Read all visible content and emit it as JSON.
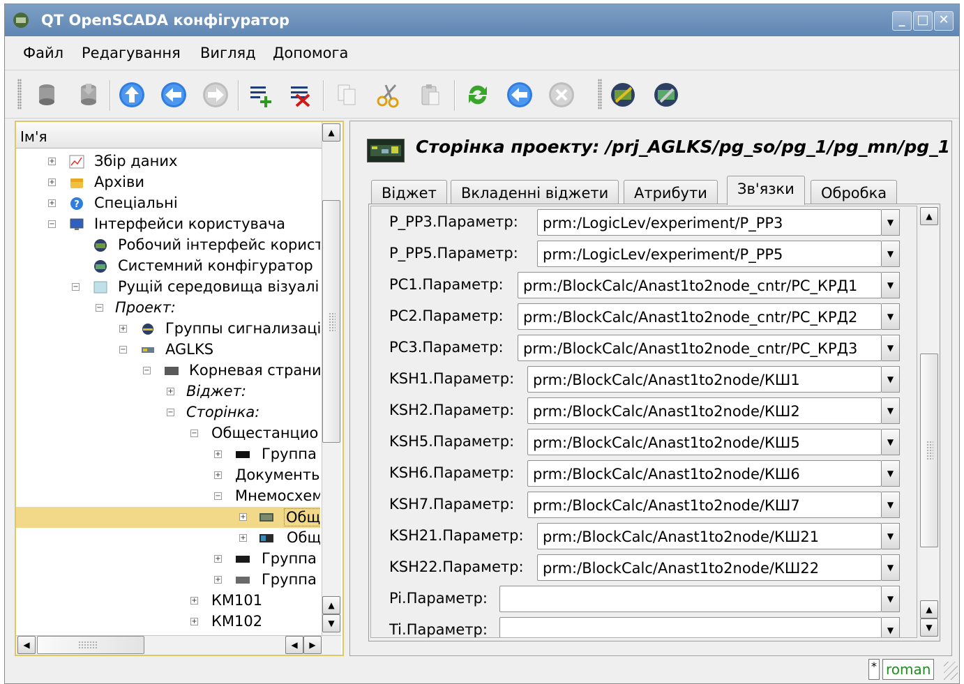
{
  "window": {
    "title": "QT OpenSCADA конфігуратор",
    "buttons": [
      "_",
      "□",
      "✕"
    ]
  },
  "menu": [
    {
      "label": "Файл"
    },
    {
      "label": "Редагування"
    },
    {
      "label": "Вигляд"
    },
    {
      "label": "Допомога"
    }
  ],
  "toolbar": {
    "icons": [
      "db-load-icon",
      "db-save-icon",
      "arrow-up-icon",
      "arrow-back-icon",
      "arrow-forward-icon",
      "add-item-icon",
      "delete-item-icon",
      "copy-icon",
      "cut-icon",
      "paste-icon",
      "refresh-icon",
      "start-icon",
      "stop-icon",
      "vision-module-icon",
      "qt-cfg-module-icon"
    ]
  },
  "tree": {
    "header": "Ім'я",
    "items": [
      {
        "label": "Збір даних",
        "expander": "+",
        "italic": false
      },
      {
        "label": "Архіви",
        "expander": "+",
        "italic": false
      },
      {
        "label": "Спеціальні",
        "expander": "+",
        "italic": false
      },
      {
        "label": "Інтерфейси користувача",
        "expander": "−",
        "italic": false
      },
      {
        "label": "Робочий інтерфейс корист",
        "expander": "",
        "italic": false
      },
      {
        "label": "Системний конфігуратор",
        "expander": "",
        "italic": false
      },
      {
        "label": "Рущій середовища візуалі",
        "expander": "−",
        "italic": false
      },
      {
        "label": "Проект:",
        "expander": "−",
        "italic": true
      },
      {
        "label": "Группы сигнализаці",
        "expander": "+",
        "italic": false
      },
      {
        "label": "AGLKS",
        "expander": "−",
        "italic": false
      },
      {
        "label": "Корневая страни",
        "expander": "−",
        "italic": false
      },
      {
        "label": "Віджет:",
        "expander": "+",
        "italic": true
      },
      {
        "label": "Сторінка:",
        "expander": "−",
        "italic": true
      },
      {
        "label": "Общестанцио",
        "expander": "−",
        "italic": false
      },
      {
        "label": "Группа",
        "expander": "+",
        "italic": false
      },
      {
        "label": "Документь",
        "expander": "+",
        "italic": false
      },
      {
        "label": "Мнемосхем",
        "expander": "−",
        "italic": false
      },
      {
        "label": "Общ",
        "expander": "+",
        "italic": false
      },
      {
        "label": "Общ",
        "expander": "+",
        "italic": false
      },
      {
        "label": "Группа",
        "expander": "+",
        "italic": false
      },
      {
        "label": "Группа",
        "expander": "+",
        "italic": false
      },
      {
        "label": "КМ101",
        "expander": "+",
        "italic": false
      },
      {
        "label": "КМ102",
        "expander": "+",
        "italic": false
      }
    ]
  },
  "page": {
    "title": "Сторінка проекту: /prj_AGLKS/pg_so/pg_1/pg_mn/pg_1"
  },
  "tabs": [
    {
      "label": "Віджет"
    },
    {
      "label": "Вкладенні віджети"
    },
    {
      "label": "Атрибути"
    },
    {
      "label": "Зв'язки"
    },
    {
      "label": "Обробка"
    }
  ],
  "links": [
    {
      "label": "P_PP3.Параметр:",
      "value": "prm:/LogicLev/experiment/P_PP3"
    },
    {
      "label": "P_PP5.Параметр:",
      "value": "prm:/LogicLev/experiment/P_PP5"
    },
    {
      "label": "PC1.Параметр:",
      "value": "prm:/BlockCalc/Anast1to2node_cntr/PC_КРД1"
    },
    {
      "label": "PC2.Параметр:",
      "value": "prm:/BlockCalc/Anast1to2node_cntr/PC_КРД2"
    },
    {
      "label": "PC3.Параметр:",
      "value": "prm:/BlockCalc/Anast1to2node_cntr/PC_КРД3"
    },
    {
      "label": "KSH1.Параметр:",
      "value": "prm:/BlockCalc/Anast1to2node/КШ1"
    },
    {
      "label": "KSH2.Параметр:",
      "value": "prm:/BlockCalc/Anast1to2node/КШ2"
    },
    {
      "label": "KSH5.Параметр:",
      "value": "prm:/BlockCalc/Anast1to2node/КШ5"
    },
    {
      "label": "KSH6.Параметр:",
      "value": "prm:/BlockCalc/Anast1to2node/КШ6"
    },
    {
      "label": "KSH7.Параметр:",
      "value": "prm:/BlockCalc/Anast1to2node/КШ7"
    },
    {
      "label": "KSH21.Параметр:",
      "value": "prm:/BlockCalc/Anast1to2node/КШ21"
    },
    {
      "label": "KSH22.Параметр:",
      "value": "prm:/BlockCalc/Anast1to2node/КШ22"
    },
    {
      "label": "Pi.Параметр:",
      "value": ""
    },
    {
      "label": "Ti.Параметр:",
      "value": ""
    }
  ],
  "status": {
    "modified": "*",
    "user": "roman"
  },
  "colors": {
    "title_bar": "#6b8fba",
    "selection": "#f2d98a",
    "user_text": "#1e8f1e"
  }
}
